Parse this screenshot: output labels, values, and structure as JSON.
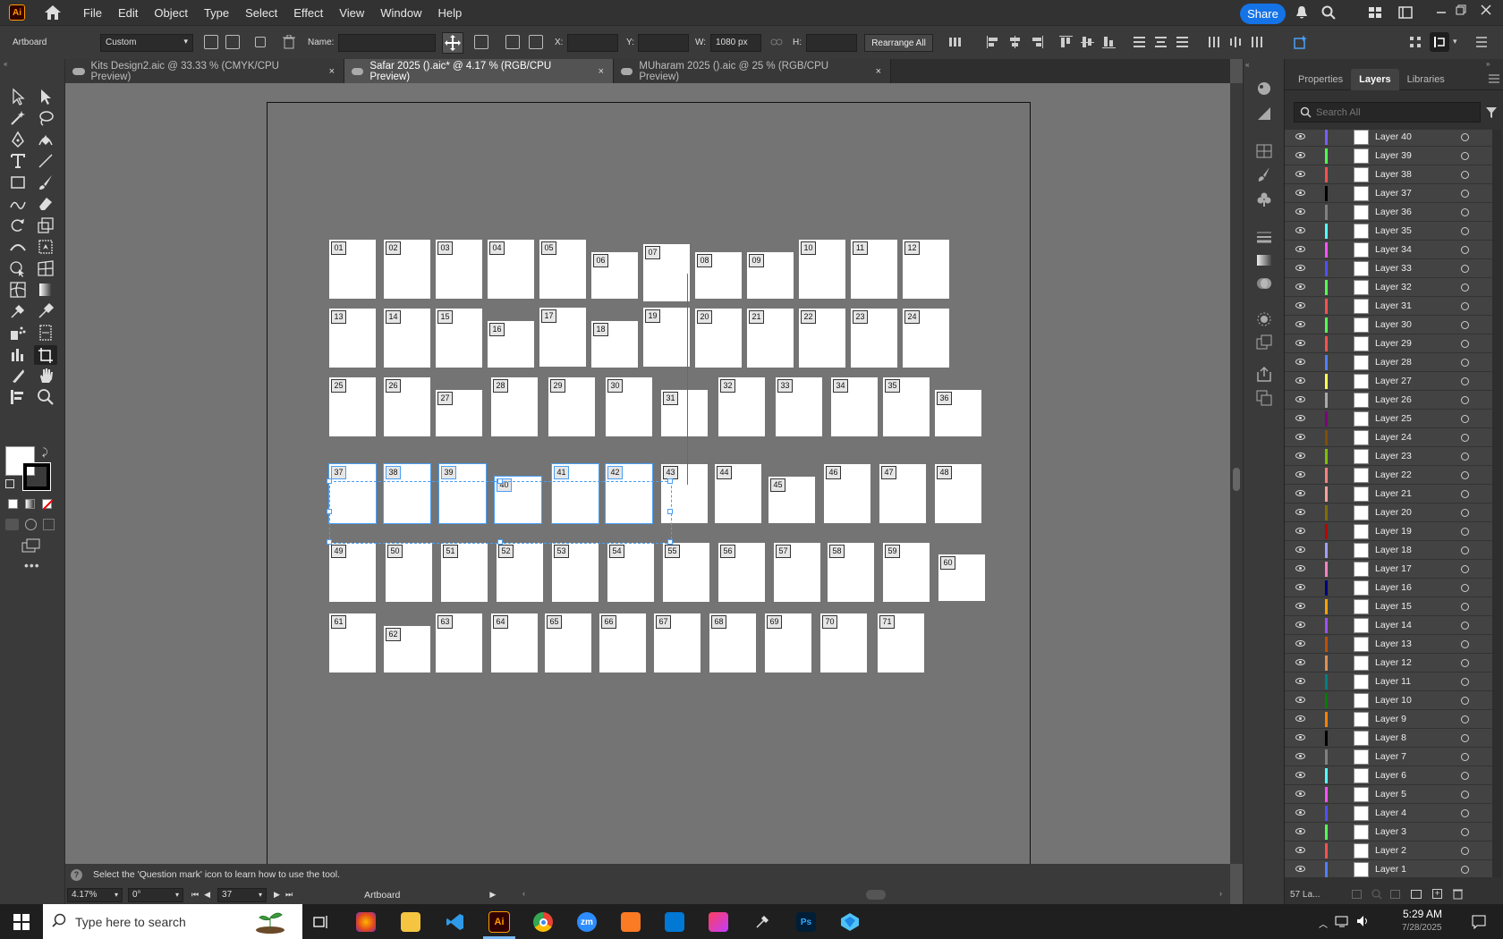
{
  "app": {
    "logo_text": "Ai"
  },
  "menus": [
    "File",
    "Edit",
    "Object",
    "Type",
    "Select",
    "Effect",
    "View",
    "Window",
    "Help"
  ],
  "share_label": "Share",
  "control_bar": {
    "context": "Artboard",
    "preset": "Custom",
    "name_label": "Name:",
    "name_value": "",
    "x_label": "X:",
    "x_value": "",
    "y_label": "Y:",
    "y_value": "",
    "w_label": "W:",
    "w_value": "1080 px",
    "h_label": "H:",
    "h_value": "",
    "rearrange_label": "Rearrange All"
  },
  "tabs": [
    {
      "label": "Kits Design2.aic @ 33.33 % (CMYK/CPU Preview)",
      "close": "×"
    },
    {
      "label": "Safar 2025 ().aic* @ 4.17 % (RGB/CPU Preview)",
      "close": "×"
    },
    {
      "label": "MUharam 2025 ().aic @ 25 % (RGB/CPU Preview)",
      "close": "×"
    }
  ],
  "artboards": [
    "01",
    "02",
    "03",
    "04",
    "05",
    "06",
    "07",
    "08",
    "09",
    "10",
    "11",
    "12",
    "13",
    "14",
    "15",
    "16",
    "17",
    "18",
    "19",
    "20",
    "21",
    "22",
    "23",
    "24",
    "25",
    "26",
    "27",
    "28",
    "29",
    "30",
    "31",
    "32",
    "33",
    "34",
    "35",
    "36",
    "37",
    "38",
    "39",
    "40",
    "41",
    "42",
    "43",
    "44",
    "45",
    "46",
    "47",
    "48",
    "49",
    "50",
    "51",
    "52",
    "53",
    "54",
    "55",
    "56",
    "57",
    "58",
    "59",
    "60",
    "61",
    "62",
    "63",
    "64",
    "65",
    "66",
    "67",
    "68",
    "69",
    "70",
    "71"
  ],
  "status": {
    "help_text": "Select the 'Question mark' icon to learn how to use the tool.",
    "zoom": "4.17%",
    "rotation": "0°",
    "artboard_num": "37",
    "tool_name": "Artboard"
  },
  "panel": {
    "tabs": [
      "Properties",
      "Layers",
      "Libraries"
    ],
    "search_placeholder": "Search All",
    "footer_count": "57 La...",
    "layers": [
      {
        "name": "Layer 40",
        "color": "#7a5cff"
      },
      {
        "name": "Layer 39",
        "color": "#4cff4c"
      },
      {
        "name": "Layer 38",
        "color": "#ff4f4f"
      },
      {
        "name": "Layer 37",
        "color": "#000000"
      },
      {
        "name": "Layer 36",
        "color": "#808080"
      },
      {
        "name": "Layer 35",
        "color": "#4fffff"
      },
      {
        "name": "Layer 34",
        "color": "#ff4fff"
      },
      {
        "name": "Layer 33",
        "color": "#4f4fff"
      },
      {
        "name": "Layer 32",
        "color": "#4fff4f"
      },
      {
        "name": "Layer 31",
        "color": "#ff4f4f"
      },
      {
        "name": "Layer 30",
        "color": "#4fff4f"
      },
      {
        "name": "Layer 29",
        "color": "#ff4f4f"
      },
      {
        "name": "Layer 28",
        "color": "#4f7fff"
      },
      {
        "name": "Layer 27",
        "color": "#ffff4f"
      },
      {
        "name": "Layer 26",
        "color": "#aaaaaa"
      },
      {
        "name": "Layer 25",
        "color": "#7f007f"
      },
      {
        "name": "Layer 24",
        "color": "#7f4f00"
      },
      {
        "name": "Layer 23",
        "color": "#7fbf00"
      },
      {
        "name": "Layer 22",
        "color": "#ff7f7f"
      },
      {
        "name": "Layer 21",
        "color": "#ff9f9f"
      },
      {
        "name": "Layer 20",
        "color": "#7f6f00"
      },
      {
        "name": "Layer 19",
        "color": "#bf0000"
      },
      {
        "name": "Layer 18",
        "color": "#9f9fff"
      },
      {
        "name": "Layer 17",
        "color": "#ff7fbf"
      },
      {
        "name": "Layer 16",
        "color": "#00007f"
      },
      {
        "name": "Layer 15",
        "color": "#ff9f00"
      },
      {
        "name": "Layer 14",
        "color": "#9f4fff"
      },
      {
        "name": "Layer 13",
        "color": "#bf4f00"
      },
      {
        "name": "Layer 12",
        "color": "#df8f4f"
      },
      {
        "name": "Layer 11",
        "color": "#007f7f"
      },
      {
        "name": "Layer 10",
        "color": "#007f00"
      },
      {
        "name": "Layer 9",
        "color": "#ff7f00"
      },
      {
        "name": "Layer 8",
        "color": "#000000"
      },
      {
        "name": "Layer 7",
        "color": "#808080"
      },
      {
        "name": "Layer 6",
        "color": "#4fffff"
      },
      {
        "name": "Layer 5",
        "color": "#ff4fff"
      },
      {
        "name": "Layer 4",
        "color": "#4f4fff"
      },
      {
        "name": "Layer 3",
        "color": "#4fff4f"
      },
      {
        "name": "Layer 2",
        "color": "#ff4f4f"
      },
      {
        "name": "Layer 1",
        "color": "#4f7fff"
      }
    ]
  },
  "taskbar": {
    "search_placeholder": "Type here to search",
    "time": "5:29 AM",
    "date": "7/28/2025",
    "apps": [
      "firefox",
      "files",
      "vscode",
      "illustrator",
      "chrome",
      "zoom",
      "xampp",
      "outlook",
      "creative-cloud",
      "pen-tool",
      "photoshop",
      "other-app"
    ],
    "app_labels": {
      "illustrator": "Ai",
      "zoom": "zm",
      "photoshop": "Ps"
    }
  }
}
